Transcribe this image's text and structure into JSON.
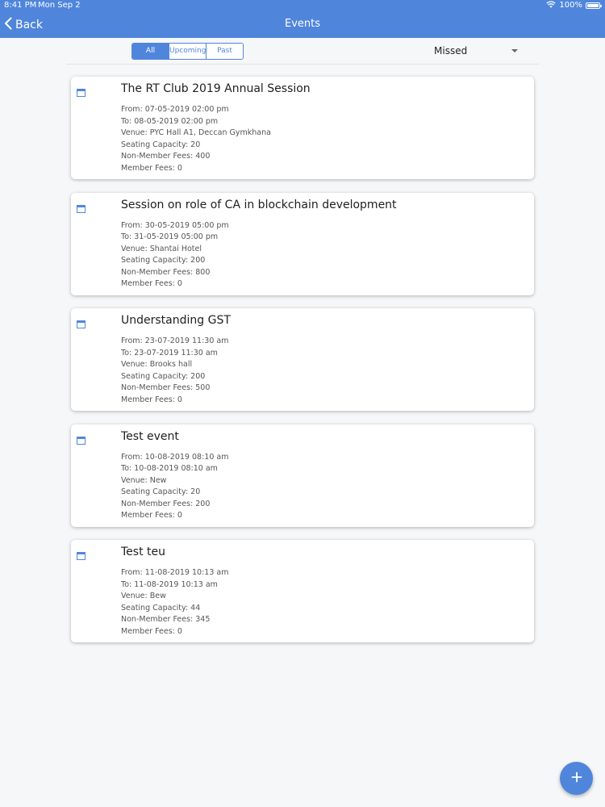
{
  "status_bar": {
    "time": "8:41 PM",
    "date": "Mon Sep 2",
    "battery": "100%",
    "battery_level": 1.0,
    "wifi_icon": "wifi-icon",
    "battery_icon": "battery-icon"
  },
  "nav": {
    "back_label": "Back",
    "back_icon": "chevron-left-icon",
    "title": "Events"
  },
  "filters": {
    "tabs": [
      {
        "label": "All",
        "active": true
      },
      {
        "label": "Upcoming",
        "active": false
      },
      {
        "label": "Past",
        "active": false
      }
    ],
    "dropdown_value": "Missed",
    "dropdown_icon": "caret-down-icon"
  },
  "events": [
    {
      "title": "The RT Club 2019 Annual Session",
      "from": "From: 07-05-2019 02:00 pm",
      "to": "To: 08-05-2019 02:00 pm",
      "venue": "Venue: PYC Hall A1, Deccan Gymkhana",
      "seating": "Seating Capacity: 20",
      "non_member_fees": "Non-Member Fees: 400",
      "member_fees": "Member Fees: 0"
    },
    {
      "title": "Session on role of CA in blockchain development",
      "from": "From: 30-05-2019 05:00 pm",
      "to": "To: 31-05-2019 05:00 pm",
      "venue": "Venue: Shantai Hotel",
      "seating": "Seating Capacity: 200",
      "non_member_fees": "Non-Member Fees: 800",
      "member_fees": "Member Fees: 0"
    },
    {
      "title": "Understanding GST",
      "from": "From: 23-07-2019 11:30 am",
      "to": "To: 23-07-2019 11:30 am",
      "venue": "Venue: Brooks hall",
      "seating": "Seating Capacity: 200",
      "non_member_fees": "Non-Member Fees: 500",
      "member_fees": "Member Fees: 0"
    },
    {
      "title": "Test event",
      "from": "From: 10-08-2019 08:10 am",
      "to": "To: 10-08-2019 08:10 am",
      "venue": "Venue: New",
      "seating": "Seating Capacity: 20",
      "non_member_fees": "Non-Member Fees: 200",
      "member_fees": "Member Fees: 0"
    },
    {
      "title": "Test teu",
      "from": "From: 11-08-2019 10:13 am",
      "to": "To: 11-08-2019 10:13 am",
      "venue": "Venue: Bew",
      "seating": "Seating Capacity: 44",
      "non_member_fees": "Non-Member Fees: 345",
      "member_fees": "Member Fees: 0"
    }
  ],
  "event_icon": "calendar-icon",
  "fab": {
    "icon": "plus-icon"
  },
  "colors": {
    "accent": "#4f86dc",
    "background": "#f6f7f9",
    "card": "#ffffff"
  }
}
